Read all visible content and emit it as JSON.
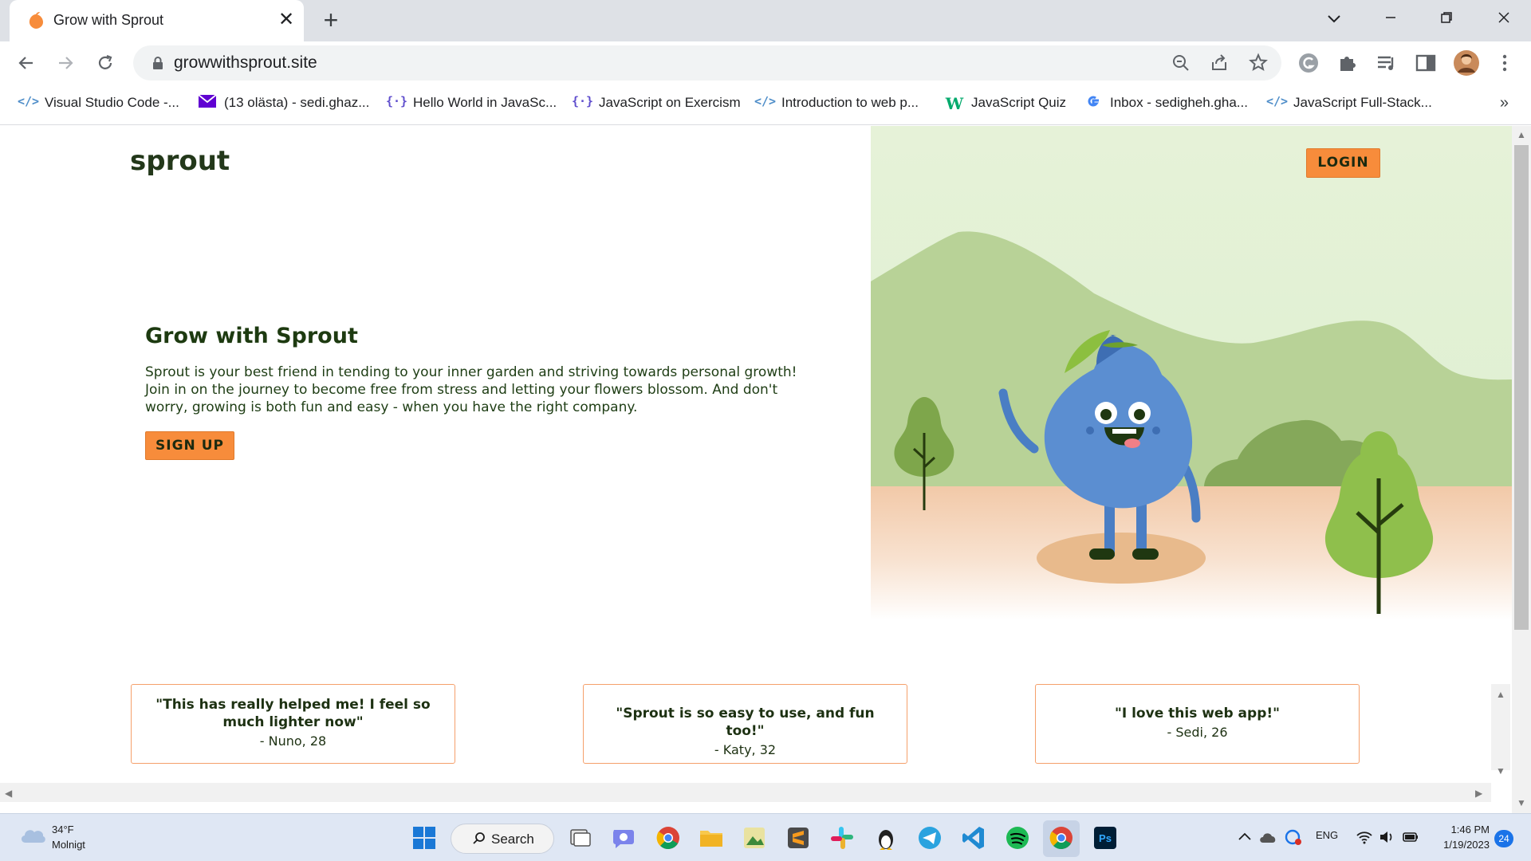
{
  "browser": {
    "tab_title": "Grow with Sprout",
    "url": "growwithsprout.site",
    "bookmarks": [
      {
        "label": "Visual Studio Code -...",
        "icon": "code-icon"
      },
      {
        "label": "(13 olästa) - sedi.ghaz...",
        "icon": "mail-icon"
      },
      {
        "label": "Hello World in JavaSc...",
        "icon": "exercism-icon"
      },
      {
        "label": "JavaScript on Exercism",
        "icon": "exercism-icon"
      },
      {
        "label": "Introduction to web p...",
        "icon": "code-icon"
      },
      {
        "label": "JavaScript Quiz",
        "icon": "w3schools-icon"
      },
      {
        "label": "Inbox - sedigheh.gha...",
        "icon": "google-icon"
      },
      {
        "label": "JavaScript Full-Stack...",
        "icon": "code-icon"
      }
    ],
    "more_bookmarks": "»"
  },
  "page": {
    "logo": "sprout",
    "login_label": "LOGIN",
    "hero": {
      "title": "Grow with Sprout",
      "text": "Sprout is your best friend in tending to your inner garden and striving towards personal growth! Join in on the journey to become free from stress and letting your flowers blossom. And don't worry, growing is both fun and easy - when you have the right company.",
      "signup_label": "SIGN UP"
    },
    "testimonials": [
      {
        "quote": "\"This has really helped me! I feel so much lighter now\"",
        "author": "- Nuno, 28"
      },
      {
        "quote": "\"Sprout is so easy to use, and fun too!\"",
        "author": "- Katy, 32"
      },
      {
        "quote": "\"I love this web app!\"",
        "author": "- Sedi, 26"
      }
    ]
  },
  "taskbar": {
    "weather_temp": "34°F",
    "weather_desc": "Molnigt",
    "search_label": "Search",
    "language": "ENG",
    "time": "1:46 PM",
    "date": "1/19/2023",
    "notifications": "24"
  },
  "colors": {
    "accent_orange": "#f78c3b",
    "dark_green": "#1d3a10",
    "mascot_blue": "#5b8ed1"
  }
}
